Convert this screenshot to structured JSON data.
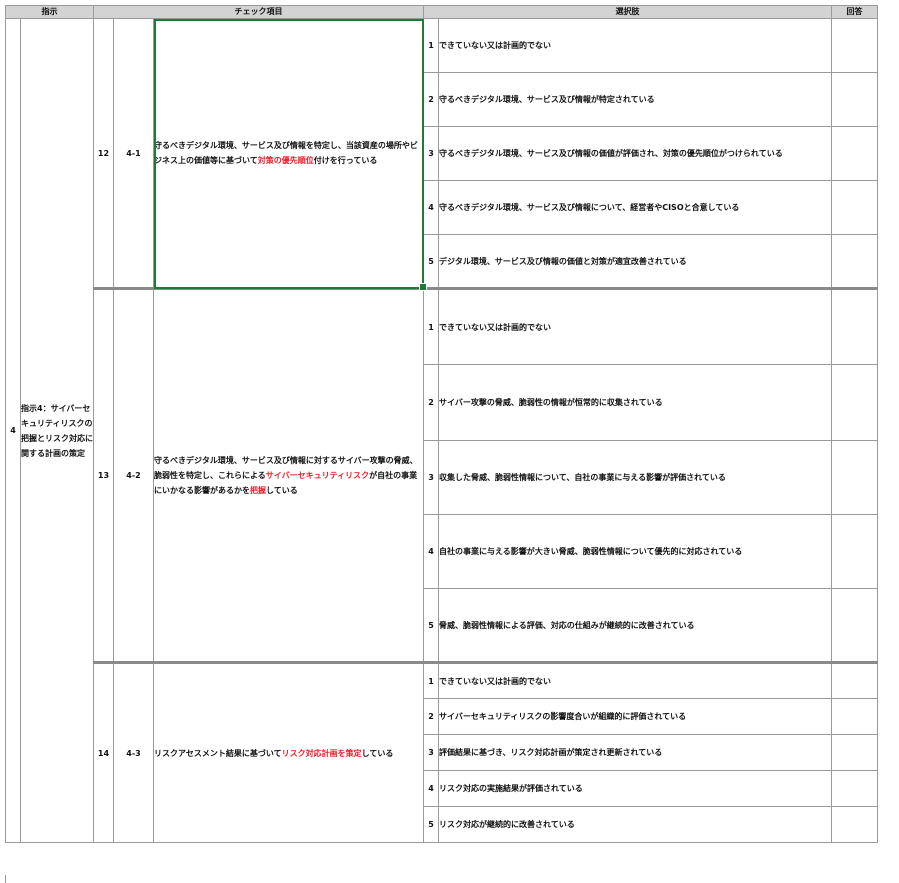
{
  "headers": {
    "instruction": "指示",
    "check_item": "チェック項目",
    "choices": "選択肢",
    "answer": "回答"
  },
  "instruction": {
    "number": "4",
    "text": "指示4：サイバーセキュリティリスクの把握とリスク対応に関する計画の策定"
  },
  "items": [
    {
      "no": "12",
      "code": "4-1",
      "check_parts": [
        {
          "text": "守るべきデジタル環境、サービス及び情報を特定し、当該資産の場所やビジネス上の価値等に基づいて",
          "red": false
        },
        {
          "text": "対策の優先順位",
          "red": true
        },
        {
          "text": "付けを行っている",
          "red": false
        }
      ],
      "options": [
        {
          "n": "1",
          "text": "できていない又は計画的でない"
        },
        {
          "n": "2",
          "text": "守るべきデジタル環境、サービス及び情報が特定されている"
        },
        {
          "n": "3",
          "text": "守るべきデジタル環境、サービス及び情報の価値が評価され、対策の優先順位がつけられている"
        },
        {
          "n": "4",
          "text": "守るべきデジタル環境、サービス及び情報について、経営者やCISOと合意している"
        },
        {
          "n": "5",
          "text": "デジタル環境、サービス及び情報の価値と対策が適宜改善されている"
        }
      ]
    },
    {
      "no": "13",
      "code": "4-2",
      "check_parts": [
        {
          "text": "守るべきデジタル環境、サービス及び情報に対するサイバー攻撃の脅威、脆弱性を特定し、これらによる",
          "red": false
        },
        {
          "text": "サイバーセキュリティリスク",
          "red": true
        },
        {
          "text": "が自社の事業にいかなる影響があるかを",
          "red": false
        },
        {
          "text": "把握",
          "red": true
        },
        {
          "text": "している",
          "red": false
        }
      ],
      "options": [
        {
          "n": "1",
          "text": "できていない又は計画的でない"
        },
        {
          "n": "2",
          "text": "サイバー攻撃の脅威、脆弱性の情報が恒常的に収集されている"
        },
        {
          "n": "3",
          "text": "収集した脅威、脆弱性情報について、自社の事業に与える影響が評価されている"
        },
        {
          "n": "4",
          "text": "自社の事業に与える影響が大きい脅威、脆弱性情報について優先的に対応されている"
        },
        {
          "n": "5",
          "text": "脅威、脆弱性情報による評価、対応の仕組みが継続的に改善されている"
        }
      ]
    },
    {
      "no": "14",
      "code": "4-3",
      "check_parts": [
        {
          "text": "リスクアセスメント結果に基づいて",
          "red": false
        },
        {
          "text": "リスク対応計画を策定",
          "red": true
        },
        {
          "text": "している",
          "red": false
        }
      ],
      "options": [
        {
          "n": "1",
          "text": "できていない又は計画的でない"
        },
        {
          "n": "2",
          "text": "サイバーセキュリティリスクの影響度合いが組織的に評価されている"
        },
        {
          "n": "3",
          "text": "評価結果に基づき、リスク対応計画が策定され更新されている"
        },
        {
          "n": "4",
          "text": "リスク対応の実施結果が評価されている"
        },
        {
          "n": "5",
          "text": "リスク対応が継続的に改善されている"
        }
      ]
    }
  ]
}
